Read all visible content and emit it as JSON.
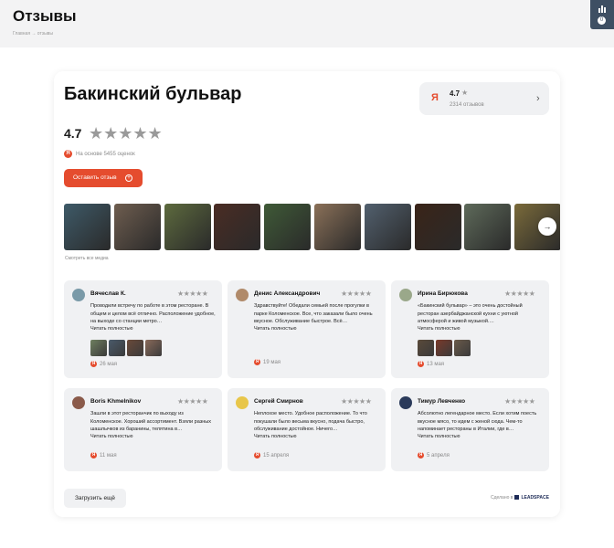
{
  "header": {
    "title": "Отзывы",
    "breadcrumb": "Главная → отзывы",
    "widget_badge": "0",
    "widget_icon": "chart-icon"
  },
  "widget": {
    "place_name": "Бакинский бульвар",
    "summary": {
      "logo": "Я",
      "rating": "4.7",
      "star": "★",
      "reviews_count": "2314 отзывов",
      "arrow": "›"
    },
    "rating_value": "4.7",
    "rating_stars": "★★★★★",
    "based_on": "На основе 5455 оценок",
    "leave_review_label": "Оставить отзыв",
    "leave_review_icon": "+",
    "media_next": "→",
    "see_all_media": "Смотреть все медиа",
    "media_colors": [
      "#3e5a68",
      "#6e5d4f",
      "#5d6a3e",
      "#4a2c24",
      "#3f5a37",
      "#8a7058",
      "#52606e",
      "#3a2418",
      "#5e6a5a",
      "#7a6a3a"
    ],
    "yandex_color": "#e54c2e",
    "accent_color": "#e54c2e",
    "load_more_label": "Загрузить ещё",
    "made_by_label": "Сделано в",
    "made_by_brand": "LEADSPACE"
  },
  "reviews": [
    {
      "author": "Вячеслав К.",
      "stars": "★★★★★",
      "text": "Проводили встречу по работе в этом ресторане. В общем и целом всё отлично. Расположение удобное, на выходе со станции метро…",
      "more": "Читать полностью",
      "date": "26 мая",
      "avatar_color": "#7a9aa8",
      "photo_colors": [
        "#6e7f5f",
        "#4a5a6a",
        "#6a4a3a",
        "#8a6a5a"
      ]
    },
    {
      "author": "Денис Александрович",
      "stars": "★★★★★",
      "text": "Здравствуйте! Обедали семьей после прогулки в парке Коломенское. Все, что заказали было очень вкусное. Обслуживание быстрое. Всё…",
      "more": "Читать полностью",
      "date": "19 мая",
      "avatar_color": "#b08a6a",
      "photo_colors": []
    },
    {
      "author": "Ирина Бирюкова",
      "stars": "★★★★★",
      "text": "«Бакинский бульвар» – это очень достойный ресторан азербайджанской кухни с уютной атмосферой и живой музыкой.…",
      "more": "Читать полностью",
      "date": "13 мая",
      "avatar_color": "#9aa88a",
      "photo_colors": [
        "#5a4a3a",
        "#7a3a2a",
        "#6a5a4a"
      ]
    },
    {
      "author": "Boris Khmelnikov",
      "stars": "★★★★★",
      "text": "Зашли в этот ресторанчик по выходу из Коломенское. Хороший ассортимент. Взяли разных шашлычков из баранины, телятина в…",
      "more": "Читать полностью",
      "date": "11 мая",
      "avatar_color": "#8a5a4a",
      "photo_colors": []
    },
    {
      "author": "Сергей Смирнов",
      "stars": "★★★★★",
      "text": "Неплохое место. Удобное расположение. То что покушали было весьма вкусно, подача быстро, обслуживание достойное. Ничего…",
      "more": "Читать полностью",
      "date": "15 апреля",
      "avatar_color": "#e8c64a",
      "photo_colors": []
    },
    {
      "author": "Тимур Левченко",
      "stars": "★★★★★",
      "text": "Абсолютно легендарное место. Если хотим поесть вкусное мясо, то идем с женой сюда. Чем-то напоминает рестораны в Италии, где в…",
      "more": "Читать полностью",
      "date": "5 апреля",
      "avatar_color": "#2a3a5a",
      "photo_colors": []
    }
  ]
}
